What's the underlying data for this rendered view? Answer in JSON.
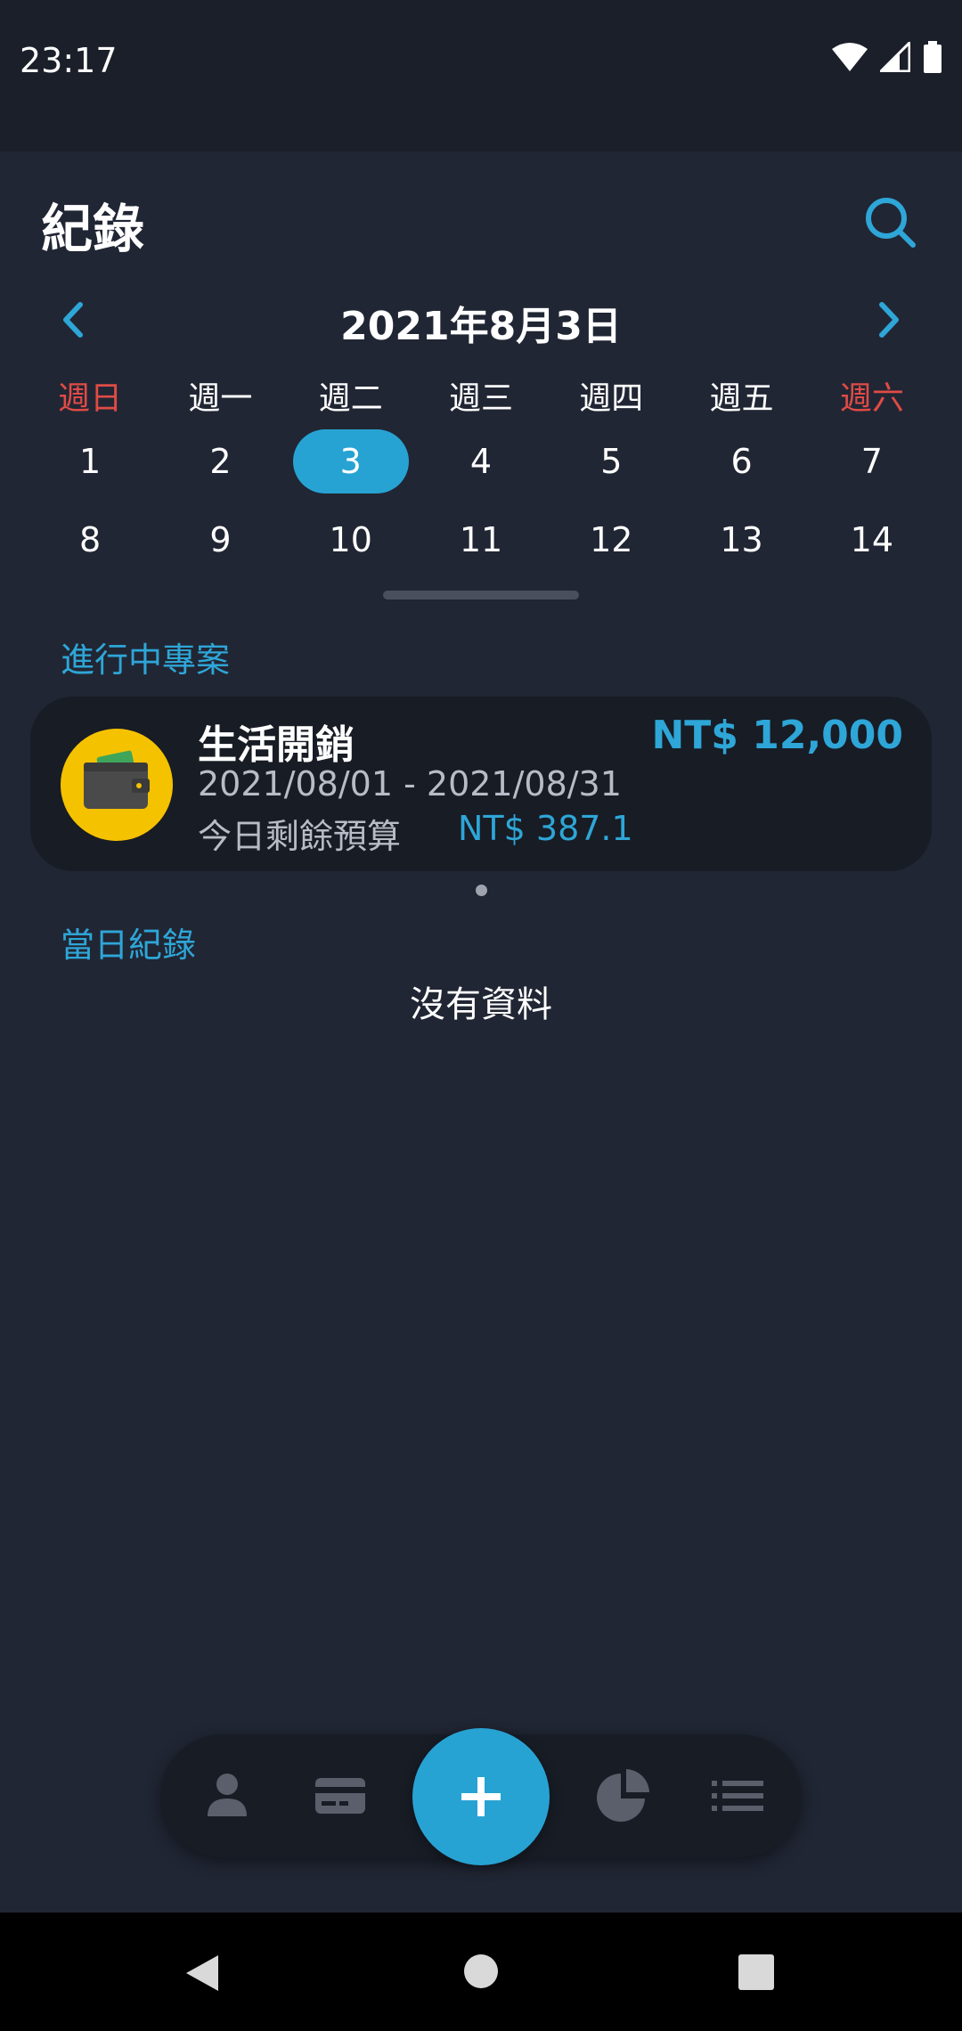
{
  "status_bar": {
    "time": "23:17"
  },
  "header": {
    "title": "紀錄"
  },
  "calendar": {
    "month_title": "2021年8月3日",
    "weekdays": [
      "週日",
      "週一",
      "週二",
      "週三",
      "週四",
      "週五",
      "週六"
    ],
    "week1": [
      "1",
      "2",
      "3",
      "4",
      "5",
      "6",
      "7"
    ],
    "week2": [
      "8",
      "9",
      "10",
      "11",
      "12",
      "13",
      "14"
    ],
    "selected_day": "3"
  },
  "sections": {
    "active_projects_label": "進行中專案",
    "daily_records_label": "當日紀錄",
    "empty_text": "沒有資料"
  },
  "project": {
    "name": "生活開銷",
    "amount": "NT$ 12,000",
    "dates": "2021/08/01 - 2021/08/31",
    "remaining_label": "今日剩餘預算",
    "remaining_value": "NT$ 387.1",
    "icon": "wallet-icon"
  },
  "colors": {
    "accent": "#27a3d3",
    "weekend": "#e04b46",
    "background": "#212634",
    "card": "#181c25"
  },
  "bottom_nav": {
    "icons": [
      "person-icon",
      "card-icon",
      "add-icon",
      "pie-chart-icon",
      "list-icon"
    ]
  }
}
